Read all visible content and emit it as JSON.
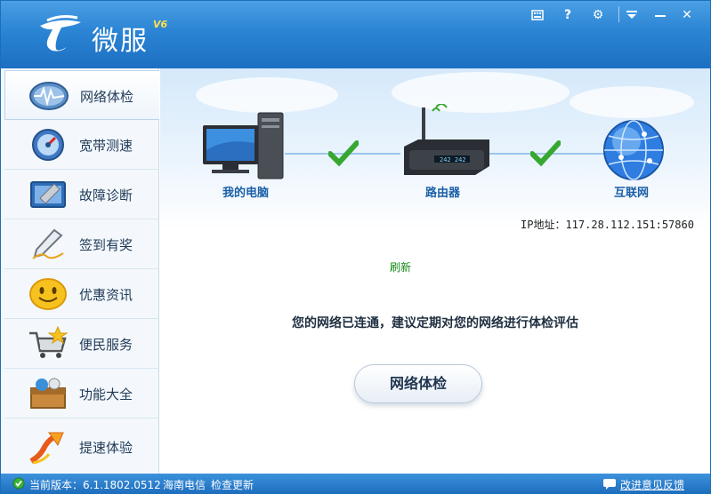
{
  "app": {
    "name": "微服",
    "version": "V6"
  },
  "titlebar": {
    "buttons": [
      {
        "name": "keyboard-icon",
        "glyph": "⌨"
      },
      {
        "name": "help-icon",
        "glyph": "?"
      },
      {
        "name": "gear-icon",
        "glyph": "⚙"
      },
      {
        "name": "dropdown-icon",
        "glyph": "▼"
      },
      {
        "name": "minimize-icon",
        "glyph": "—"
      },
      {
        "name": "close-icon",
        "glyph": "✕"
      }
    ]
  },
  "sidebar": {
    "items": [
      {
        "label": "网络体检",
        "icon": "network-check-icon",
        "active": true
      },
      {
        "label": "宽带测速",
        "icon": "speedometer-icon"
      },
      {
        "label": "故障诊断",
        "icon": "wrench-icon"
      },
      {
        "label": "签到有奖",
        "icon": "pen-icon"
      },
      {
        "label": "优惠资讯",
        "icon": "smiley-icon"
      },
      {
        "label": "便民服务",
        "icon": "shopping-cart-icon"
      },
      {
        "label": "功能大全",
        "icon": "toolbox-icon"
      },
      {
        "label": "提速体验",
        "icon": "rocket-arrow-icon"
      }
    ]
  },
  "main": {
    "nodes": {
      "computer": "我的电脑",
      "router": "路由器",
      "internet": "互联网"
    },
    "ip_label": "IP地址：117.28.112.151:57860",
    "refresh_label": "刷新",
    "message": "您的网络已连通，建议定期对您的网络进行体检评估",
    "check_button": "网络体检"
  },
  "status": {
    "version_label": "当前版本：6.1.1802.0512",
    "isp": "海南电信",
    "update_link": "检查更新",
    "feedback_link": "改进意见反馈"
  },
  "colors": {
    "accent": "#2b84d4",
    "check_green": "#36a832",
    "link_green": "#128a14"
  }
}
